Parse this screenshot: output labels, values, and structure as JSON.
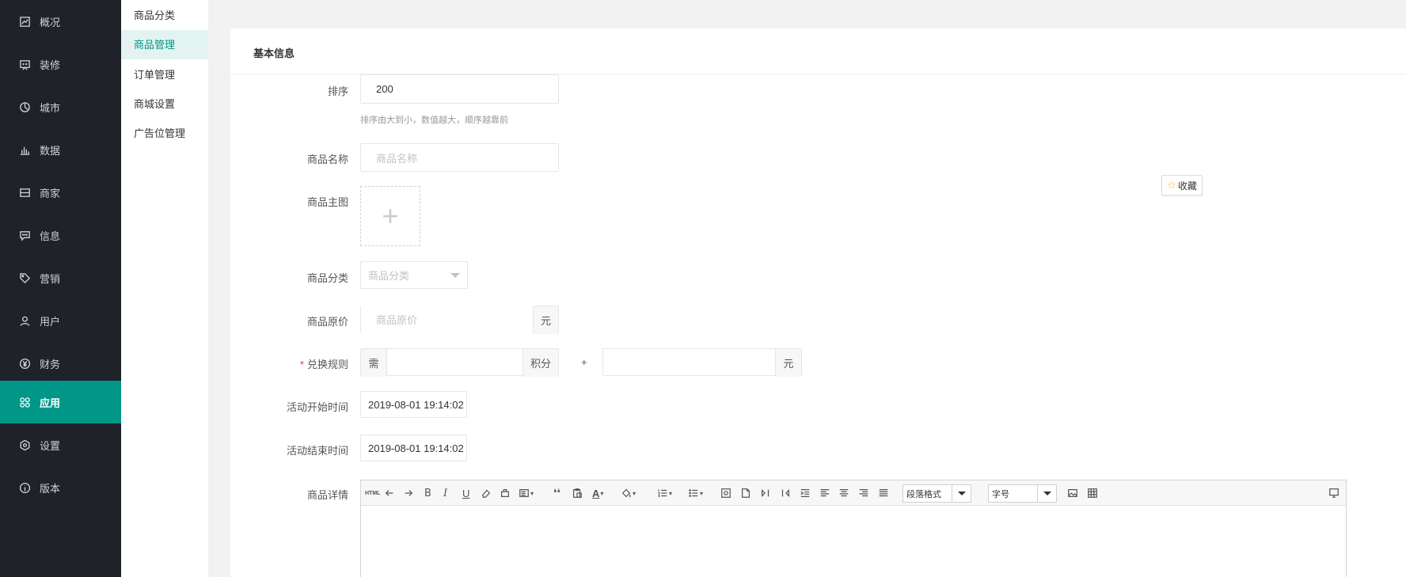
{
  "sidebar": {
    "items": [
      {
        "label": "概况",
        "icon": "overview-icon"
      },
      {
        "label": "装修",
        "icon": "decorate-icon"
      },
      {
        "label": "城市",
        "icon": "city-icon"
      },
      {
        "label": "数据",
        "icon": "data-chart-icon"
      },
      {
        "label": "商家",
        "icon": "merchant-icon"
      },
      {
        "label": "信息",
        "icon": "message-icon"
      },
      {
        "label": "营销",
        "icon": "tag-icon"
      },
      {
        "label": "用户",
        "icon": "user-icon"
      },
      {
        "label": "财务",
        "icon": "yen-icon"
      },
      {
        "label": "应用",
        "icon": "apps-icon",
        "active": true
      },
      {
        "label": "设置",
        "icon": "settings-icon"
      },
      {
        "label": "版本",
        "icon": "info-icon"
      }
    ],
    "accent": "#009688",
    "bg": "#20222a"
  },
  "submenu": {
    "items": [
      {
        "label": "商品分类"
      },
      {
        "label": "商品管理",
        "active": true
      },
      {
        "label": "订单管理"
      },
      {
        "label": "商城设置"
      },
      {
        "label": "广告位管理"
      }
    ]
  },
  "panel": {
    "title": "基本信息"
  },
  "form": {
    "sort": {
      "label": "排序",
      "value": "200",
      "hint": "排序由大到小，数值越大，顺序越靠前"
    },
    "name": {
      "label": "商品名称",
      "placeholder": "商品名称"
    },
    "image": {
      "label": "商品主图",
      "plus": "+"
    },
    "category": {
      "label": "商品分类",
      "placeholder": "商品分类"
    },
    "price": {
      "label": "商品原价",
      "placeholder": "商品原价",
      "unit": "元"
    },
    "exchange": {
      "label": "兑换规则",
      "required": "*",
      "prefix": "需",
      "points_unit": "积分",
      "plus": "+",
      "cash_unit": "元"
    },
    "start": {
      "label": "活动开始时间",
      "value": "2019-08-01 19:14:02"
    },
    "end": {
      "label": "活动结束时间",
      "value": "2019-08-01 19:14:02"
    },
    "detail": {
      "label": "商品详情"
    }
  },
  "collect": {
    "star": "☆",
    "label": "收藏"
  },
  "editor": {
    "html_label": "HTML",
    "paragraph_select": "段落格式",
    "fontsize_select": "字号"
  }
}
